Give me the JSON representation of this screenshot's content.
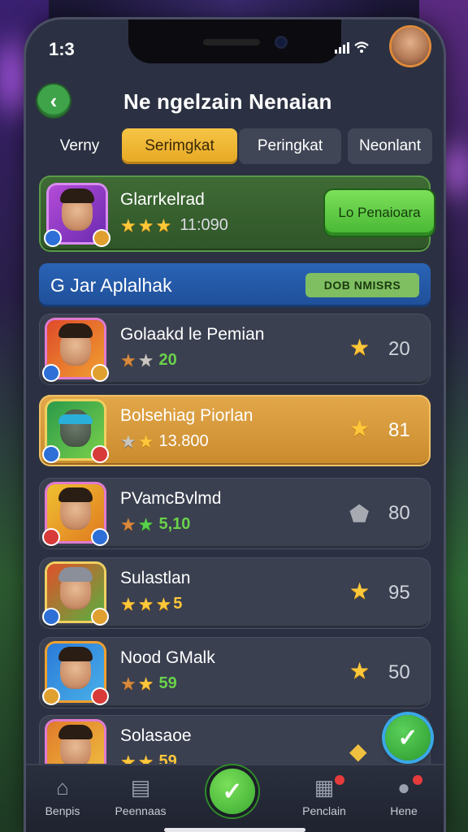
{
  "status": {
    "time": "1:3"
  },
  "header": {
    "title": "Ne ngelzain Nenaian",
    "back_icon": "chevron-left-icon"
  },
  "tabs": [
    {
      "label": "Verny",
      "state": "plain"
    },
    {
      "label": "Serimgkat",
      "state": "active"
    },
    {
      "label": "Peringkat",
      "state": "dark"
    },
    {
      "label": "Neonlant",
      "state": "dark"
    }
  ],
  "featured": {
    "name": "Glarrkelrad",
    "score": "11:090",
    "button_label": "Lo Penaioara"
  },
  "section": {
    "title": "G  Jar Aplalhak",
    "tag": "DOB NMISRS"
  },
  "players": [
    {
      "name": "Golaakd le Pemian",
      "score": "20",
      "end_value": "20",
      "highlight": false
    },
    {
      "name": "Bolsehiag Piorlan",
      "score": "13.800",
      "end_value": "81",
      "highlight": true
    },
    {
      "name": "PVamcBvlmd",
      "score": "5,10",
      "end_value": "80",
      "highlight": false
    },
    {
      "name": "Sulastlan",
      "score": "5",
      "end_value": "95",
      "highlight": false
    },
    {
      "name": "Nood GMalk",
      "score": "59",
      "end_value": "50",
      "highlight": false
    },
    {
      "name": "Solasaoe",
      "score": "59",
      "end_value": "",
      "highlight": false
    }
  ],
  "bottom_nav": [
    {
      "label": "Benpis",
      "icon": "home-icon"
    },
    {
      "label": "Peennaas",
      "icon": "document-icon"
    },
    {
      "label": "",
      "icon": "check-icon"
    },
    {
      "label": "Penclain",
      "icon": "calendar-icon"
    },
    {
      "label": "Hene",
      "icon": "profile-icon"
    }
  ],
  "colors": {
    "accent_yellow": "#f6c445",
    "accent_green": "#46b633",
    "section_blue": "#2a63b6",
    "card_dark": "#3a4050"
  }
}
